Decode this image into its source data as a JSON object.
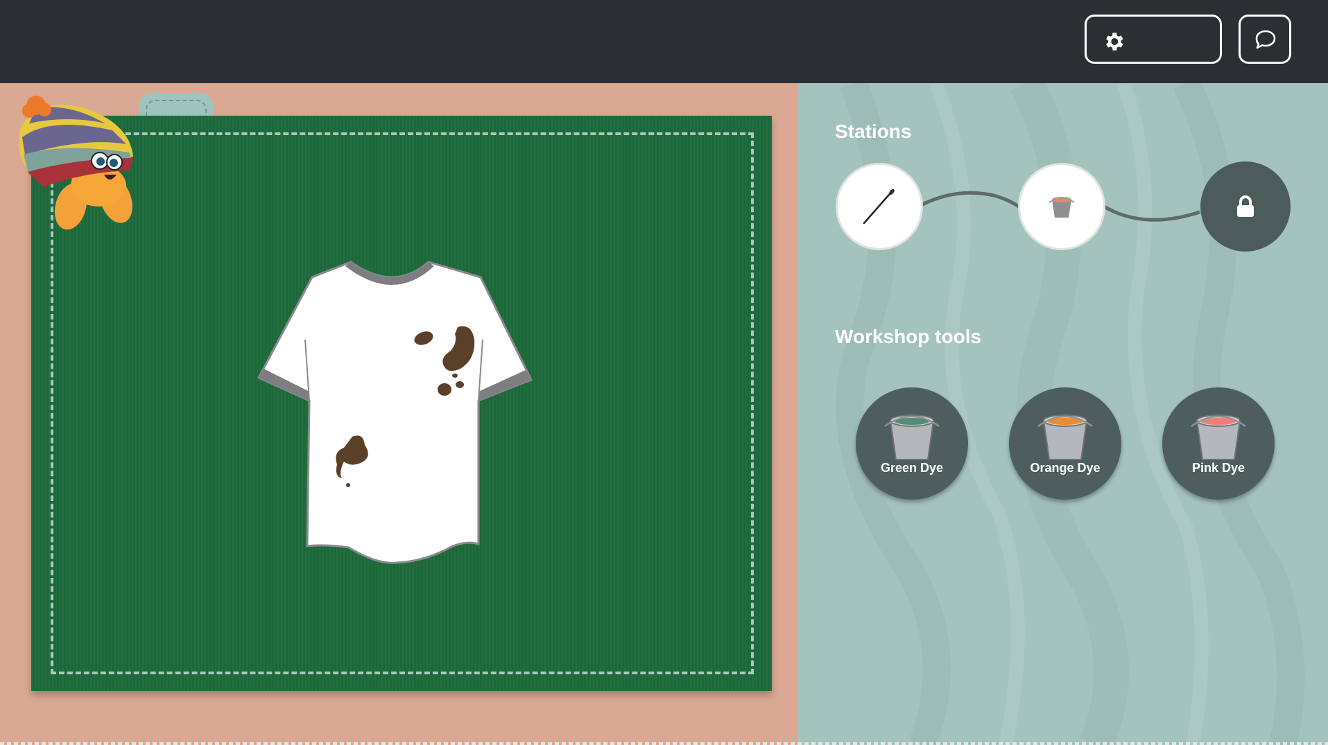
{
  "header": {
    "settings_icon": "gear-icon",
    "chat_icon": "speech-bubble-icon"
  },
  "workbench": {
    "item": "t-shirt with mud stains",
    "mascot": "hermit-crab-with-striped-hat"
  },
  "sidebar": {
    "stations_title": "Stations",
    "stations": [
      {
        "icon": "needle-icon",
        "state": "completed"
      },
      {
        "icon": "dye-bucket-icon",
        "state": "completed"
      },
      {
        "icon": "lock-icon",
        "state": "locked"
      }
    ],
    "tools_title": "Workshop tools",
    "tools": [
      {
        "label": "Green Dye",
        "color": "#4f8f74"
      },
      {
        "label": "Orange Dye",
        "color": "#f08a2c"
      },
      {
        "label": "Pink Dye",
        "color": "#ef7f73"
      }
    ]
  },
  "colors": {
    "topbar": "#2b2e33",
    "mat": "#1e6b3c",
    "workbench": "#d9a993",
    "panel": "#a4c3bd"
  }
}
